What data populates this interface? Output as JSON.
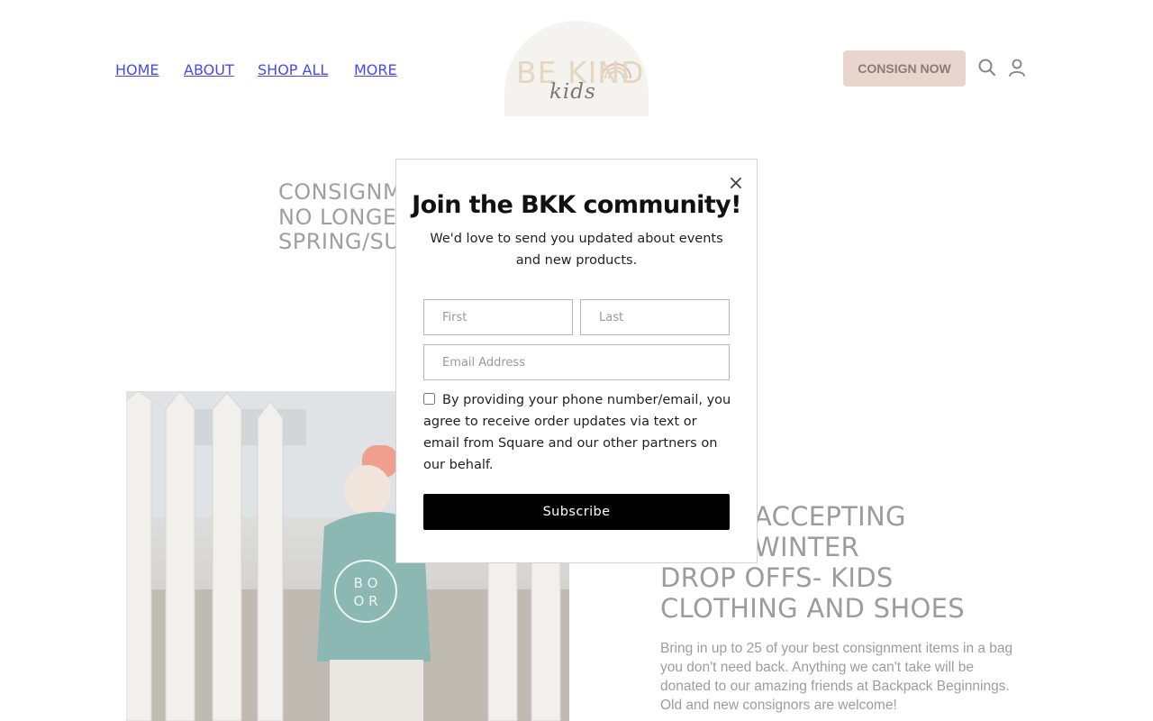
{
  "header": {
    "nav": [
      "HOME",
      "ABOUT",
      "SHOP ALL",
      "MORE"
    ],
    "logo": {
      "line1": "BE KIND",
      "line2": "kids"
    },
    "consign_label": "CONSIGN NOW",
    "icons": [
      "search-icon",
      "account-icon"
    ]
  },
  "page": {
    "headline_top_lines": [
      "CONSIGNM",
      "NO LONGER",
      "SPRING/SU"
    ],
    "headline_right_lines": [
      "ACCEPTING",
      "WINTER",
      "DROP OFFS- KIDS",
      "CLOTHING AND SHOES"
    ],
    "body_text": "Bring in up to 25 of your best consignment items in a bag you don't need back. Anything we can't take will be donated to our amazing friends at Backpack Beginnings. Old and new consignors are welcome!",
    "photo_shirt_text": "BOOR"
  },
  "modal": {
    "close_symbol": "×",
    "title": "Join the BKK community!",
    "subtitle": "We'd love to send you updated about events and new products.",
    "first_placeholder": "First",
    "last_placeholder": "Last",
    "email_placeholder": "Email Address",
    "consent_text": "By providing your phone number/email, you agree to receive order updates via text or email from Square and our other partners on our behalf.",
    "subscribe_label": "Subscribe",
    "checkbox_checked": false
  },
  "colors": {
    "consign_button": "#dfc6bc",
    "subscribe_button": "#000000",
    "logo_background": "#f1efe9",
    "logo_text": "#dcc7a6"
  }
}
